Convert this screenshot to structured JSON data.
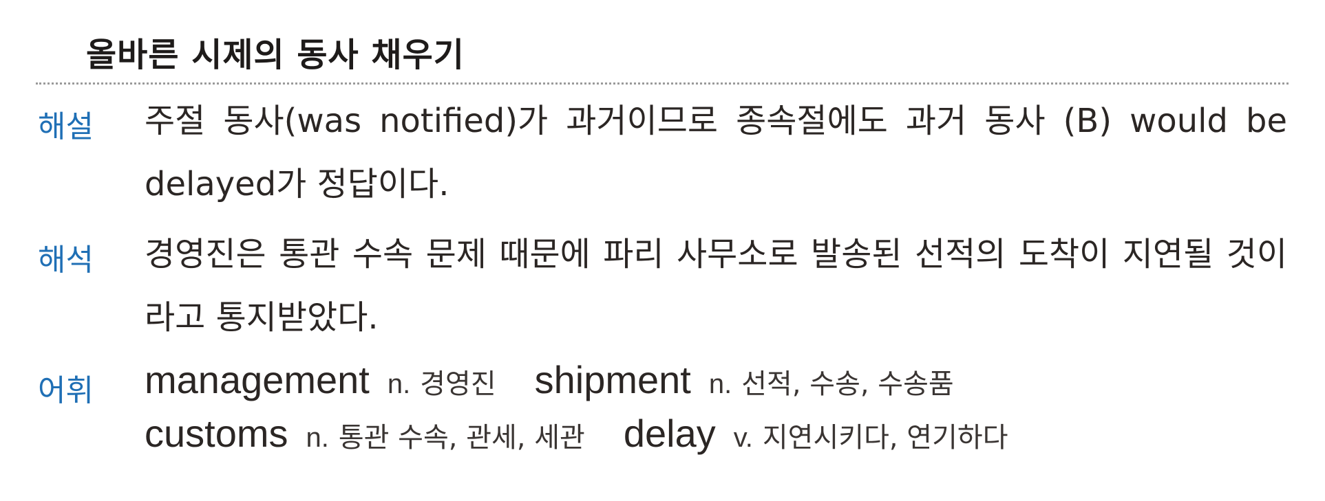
{
  "title": "올바른 시제의 동사 채우기",
  "explanation": {
    "label": "해설",
    "text": "주절 동사(was notified)가 과거이므로 종속절에도 과거 동사 (B) would be delayed가 정답이다."
  },
  "translation": {
    "label": "해석",
    "text": "경영진은 통관 수속 문제 때문에 파리 사무소로 발송된 선적의 도착이 지연될 것이라고 통지받았다."
  },
  "vocabulary": {
    "label": "어휘",
    "entries": [
      {
        "term": "management",
        "pos": "n.",
        "meaning": "경영진"
      },
      {
        "term": "shipment",
        "pos": "n.",
        "meaning": "선적, 수송, 수송품"
      },
      {
        "term": "customs",
        "pos": "n.",
        "meaning": "통관 수속, 관세, 세관"
      },
      {
        "term": "delay",
        "pos": "v.",
        "meaning": "지연시키다, 연기하다"
      }
    ]
  },
  "colors": {
    "label_blue": "#1f6fb5",
    "body_text": "#2b2624",
    "divider": "#9a9a9a"
  }
}
